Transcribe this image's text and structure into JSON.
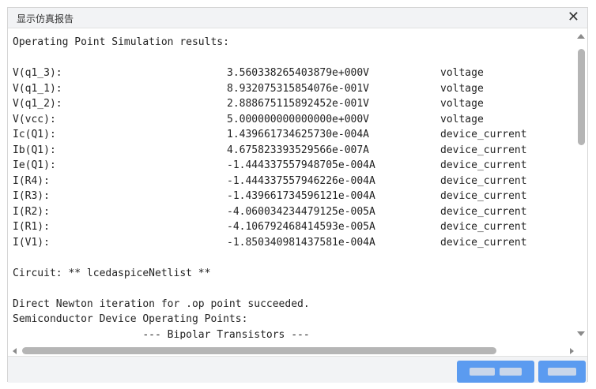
{
  "window": {
    "title": "显示仿真报告",
    "close_glyph": "✕"
  },
  "output": {
    "header": "Operating Point Simulation results:",
    "results": [
      {
        "name": "V(q1_3):",
        "value": "3.560338265403879e+000V",
        "type": "voltage"
      },
      {
        "name": "V(q1_1):",
        "value": "8.932075315854076e-001V",
        "type": "voltage"
      },
      {
        "name": "V(q1_2):",
        "value": "2.888675115892452e-001V",
        "type": "voltage"
      },
      {
        "name": "V(vcc):",
        "value": "5.000000000000000e+000V",
        "type": "voltage"
      },
      {
        "name": "Ic(Q1):",
        "value": "1.439661734625730e-004A",
        "type": "device_current"
      },
      {
        "name": "Ib(Q1):",
        "value": "4.675823393529566e-007A",
        "type": "device_current"
      },
      {
        "name": "Ie(Q1):",
        "value": "-1.444337557948705e-004A",
        "type": "device_current"
      },
      {
        "name": "I(R4):",
        "value": "-1.444337557946226e-004A",
        "type": "device_current"
      },
      {
        "name": "I(R3):",
        "value": "-1.439661734596121e-004A",
        "type": "device_current"
      },
      {
        "name": "I(R2):",
        "value": "-4.060034234479125e-005A",
        "type": "device_current"
      },
      {
        "name": "I(R1):",
        "value": "-4.106792468414593e-005A",
        "type": "device_current"
      },
      {
        "name": "I(V1):",
        "value": "-1.850340981437581e-004A",
        "type": "device_current"
      }
    ],
    "circuit_line": "Circuit: ** lcedaspiceNetlist **",
    "newton_line": "Direct Newton iteration for .op point succeeded.",
    "semiconductor_line": "Semiconductor Device Operating Points:",
    "bipolar_line": "                     --- Bipolar Transistors ---"
  },
  "colors": {
    "button": "#5b9bf0",
    "titlebar": "#f2f3f5",
    "scroll_thumb": "#b5b5b5"
  }
}
